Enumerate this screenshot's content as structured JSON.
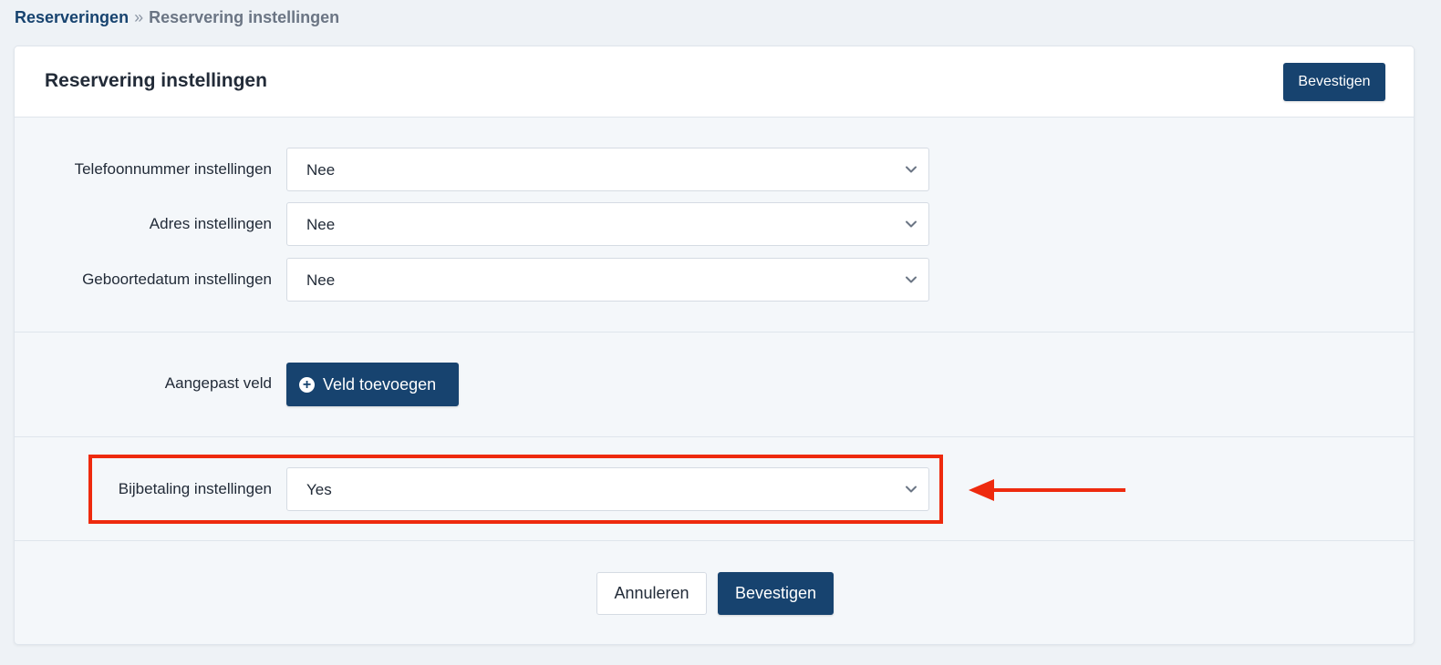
{
  "breadcrumb": {
    "parent": "Reserveringen",
    "separator": "»",
    "current": "Reservering instellingen"
  },
  "card": {
    "title": "Reservering instellingen",
    "header_confirm_label": "Bevestigen"
  },
  "settings": {
    "phone": {
      "label": "Telefoonnummer instellingen",
      "value": "Nee"
    },
    "address": {
      "label": "Adres instellingen",
      "value": "Nee"
    },
    "birthdate": {
      "label": "Geboortedatum instellingen",
      "value": "Nee"
    }
  },
  "custom_field": {
    "label": "Aangepast veld",
    "add_button_label": "Veld toevoegen",
    "add_icon": "plus-circle-icon"
  },
  "surcharge": {
    "label": "Bijbetaling instellingen",
    "value": "Yes"
  },
  "footer": {
    "cancel_label": "Annuleren",
    "confirm_label": "Bevestigen"
  },
  "colors": {
    "primary": "#17436f",
    "annotation": "#ee2a0e",
    "background": "#eef2f6"
  }
}
